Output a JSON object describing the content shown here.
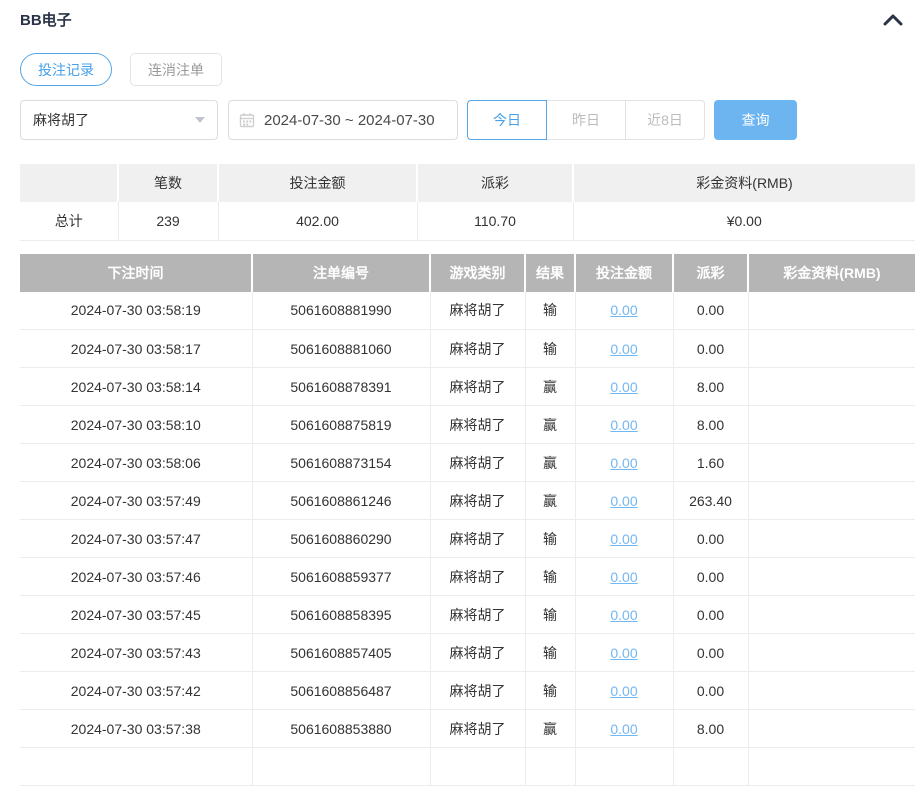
{
  "header": {
    "title": "BB电子"
  },
  "tabs": [
    {
      "label": "投注记录",
      "active": true
    },
    {
      "label": "连消注单",
      "active": false
    }
  ],
  "toolbar": {
    "game_select": {
      "value": "麻将胡了"
    },
    "date_range": {
      "value": "2024-07-30 ~ 2024-07-30"
    },
    "quick_ranges": [
      {
        "label": "今日",
        "active": true
      },
      {
        "label": "昨日",
        "active": false
      },
      {
        "label": "近8日",
        "active": false
      }
    ],
    "query_label": "查询"
  },
  "summary": {
    "headers": [
      "",
      "笔数",
      "投注金额",
      "派彩",
      "彩金资料(RMB)"
    ],
    "row": {
      "label": "总计",
      "count": "239",
      "bet_amount": "402.00",
      "payout": "110.70",
      "bonus": "¥0.00"
    }
  },
  "records": {
    "headers": [
      "下注时间",
      "注单编号",
      "游戏类别",
      "结果",
      "投注金额",
      "派彩",
      "彩金资料(RMB)"
    ],
    "rows": [
      {
        "time": "2024-07-30 03:58:19",
        "order_no": "5061608881990",
        "game": "麻将胡了",
        "result": "输",
        "bet": "0.00",
        "payout": "0.00",
        "bonus": ""
      },
      {
        "time": "2024-07-30 03:58:17",
        "order_no": "5061608881060",
        "game": "麻将胡了",
        "result": "输",
        "bet": "0.00",
        "payout": "0.00",
        "bonus": ""
      },
      {
        "time": "2024-07-30 03:58:14",
        "order_no": "5061608878391",
        "game": "麻将胡了",
        "result": "赢",
        "bet": "0.00",
        "payout": "8.00",
        "bonus": ""
      },
      {
        "time": "2024-07-30 03:58:10",
        "order_no": "5061608875819",
        "game": "麻将胡了",
        "result": "赢",
        "bet": "0.00",
        "payout": "8.00",
        "bonus": ""
      },
      {
        "time": "2024-07-30 03:58:06",
        "order_no": "5061608873154",
        "game": "麻将胡了",
        "result": "赢",
        "bet": "0.00",
        "payout": "1.60",
        "bonus": ""
      },
      {
        "time": "2024-07-30 03:57:49",
        "order_no": "5061608861246",
        "game": "麻将胡了",
        "result": "赢",
        "bet": "0.00",
        "payout": "263.40",
        "bonus": ""
      },
      {
        "time": "2024-07-30 03:57:47",
        "order_no": "5061608860290",
        "game": "麻将胡了",
        "result": "输",
        "bet": "0.00",
        "payout": "0.00",
        "bonus": ""
      },
      {
        "time": "2024-07-30 03:57:46",
        "order_no": "5061608859377",
        "game": "麻将胡了",
        "result": "输",
        "bet": "0.00",
        "payout": "0.00",
        "bonus": ""
      },
      {
        "time": "2024-07-30 03:57:45",
        "order_no": "5061608858395",
        "game": "麻将胡了",
        "result": "输",
        "bet": "0.00",
        "payout": "0.00",
        "bonus": ""
      },
      {
        "time": "2024-07-30 03:57:43",
        "order_no": "5061608857405",
        "game": "麻将胡了",
        "result": "输",
        "bet": "0.00",
        "payout": "0.00",
        "bonus": ""
      },
      {
        "time": "2024-07-30 03:57:42",
        "order_no": "5061608856487",
        "game": "麻将胡了",
        "result": "输",
        "bet": "0.00",
        "payout": "0.00",
        "bonus": ""
      },
      {
        "time": "2024-07-30 03:57:38",
        "order_no": "5061608853880",
        "game": "麻将胡了",
        "result": "赢",
        "bet": "0.00",
        "payout": "8.00",
        "bonus": ""
      }
    ]
  },
  "colors": {
    "accent_blue": "#47a0e8",
    "button_blue": "#6cb5f0",
    "link_blue": "#73b7f1",
    "table_header_gray": "#b5b5b5",
    "summary_header_gray": "#f0f0f0"
  }
}
